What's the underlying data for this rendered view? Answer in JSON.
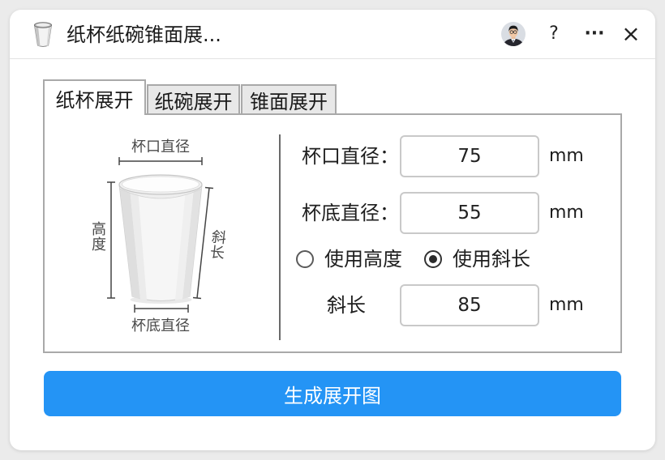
{
  "window": {
    "title": "纸杯纸碗锥面展...",
    "help_label": "?",
    "more_label": "···",
    "close_label": "×"
  },
  "icons": {
    "app": "cup-icon",
    "user": "avatar",
    "help": "help-icon",
    "more": "more-icon",
    "close": "close-icon"
  },
  "tabs": [
    {
      "label": "纸杯展开",
      "active": true
    },
    {
      "label": "纸碗展开",
      "active": false
    },
    {
      "label": "锥面展开",
      "active": false
    }
  ],
  "diagram": {
    "top_diameter_label": "杯口直径",
    "height_label": "高度",
    "slant_label": "斜长",
    "bottom_diameter_label": "杯底直径"
  },
  "form": {
    "top_diameter": {
      "label": "杯口直径：",
      "value": "75",
      "unit": "mm"
    },
    "bottom_diameter": {
      "label": "杯底直径：",
      "value": "55",
      "unit": "mm"
    },
    "mode": {
      "options": [
        {
          "label": "使用高度",
          "selected": false
        },
        {
          "label": "使用斜长",
          "selected": true
        }
      ]
    },
    "slant": {
      "label": "斜长",
      "value": "85",
      "unit": "mm"
    }
  },
  "generate_button": {
    "label": "生成展开图"
  },
  "colors": {
    "accent": "#2494f5",
    "tab_inactive": "#e8e8e8",
    "border": "#a9a9a9"
  }
}
